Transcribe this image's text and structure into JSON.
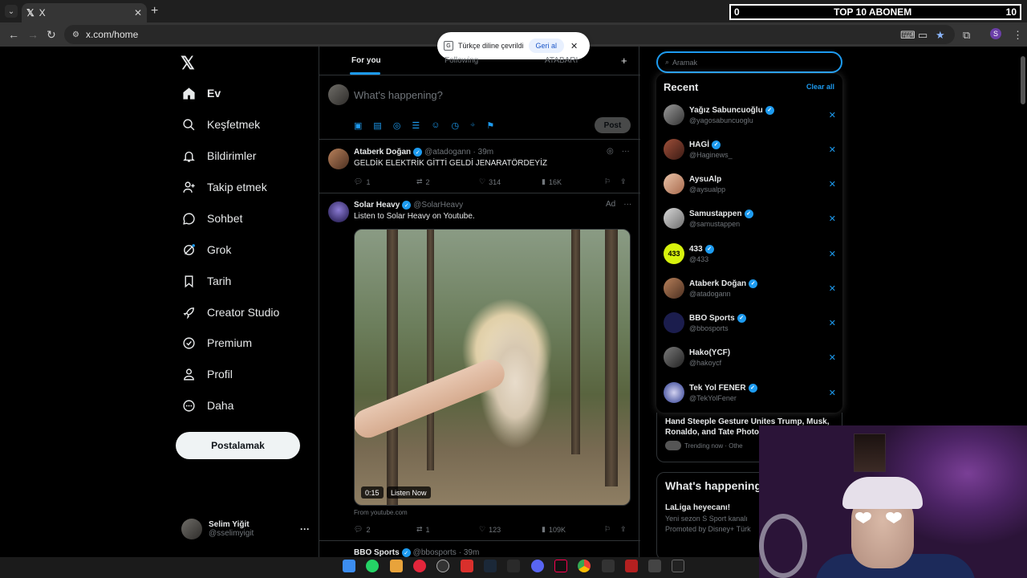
{
  "browser": {
    "tab_title": "X",
    "url": "x.com/home"
  },
  "stream_overlay": {
    "left_count": "0",
    "title": "TOP 10 ABONEM",
    "right_count": "10"
  },
  "translate_popup": {
    "text": "Türkçe diline çevrildi",
    "undo_button": "Geri al"
  },
  "sidebar": {
    "items": [
      {
        "label": "Ev",
        "icon": "home-icon"
      },
      {
        "label": "Keşfetmek",
        "icon": "search-icon"
      },
      {
        "label": "Bildirimler",
        "icon": "bell-icon"
      },
      {
        "label": "Takip etmek",
        "icon": "person-add-icon"
      },
      {
        "label": "Sohbet",
        "icon": "chat-icon"
      },
      {
        "label": "Grok",
        "icon": "grok-icon"
      },
      {
        "label": "Tarih",
        "icon": "bookmark-icon"
      },
      {
        "label": "Creator Studio",
        "icon": "rocket-icon"
      },
      {
        "label": "Premium",
        "icon": "verified-icon"
      },
      {
        "label": "Profil",
        "icon": "person-icon"
      },
      {
        "label": "Daha",
        "icon": "more-circle-icon"
      }
    ],
    "post_button": "Postalamak",
    "profile": {
      "name": "Selim Yiğit",
      "handle": "@sselimyigit"
    }
  },
  "feed": {
    "tabs": [
      "For you",
      "Following",
      "ATABARI"
    ],
    "compose_placeholder": "What's happening?",
    "compose_post_button": "Post",
    "tweets": [
      {
        "name": "Ataberk Doğan",
        "handle": "@atadogann",
        "time": "· 39m",
        "text": "GELDİK ELEKTRİK GİTTİ GELDİ JENARATÖRDEYİZ",
        "replies": "1",
        "reposts": "2",
        "likes": "314",
        "views": "16K"
      },
      {
        "name": "Solar Heavy",
        "handle": "@SolarHeavy",
        "ad_label": "Ad",
        "text": "Listen to Solar Heavy on Youtube.",
        "video_time": "0:15",
        "video_cta": "Listen Now",
        "source": "From youtube.com",
        "replies": "2",
        "reposts": "1",
        "likes": "123",
        "views": "109K"
      },
      {
        "name": "BBO Sports",
        "handle": "@bbosports",
        "time": "· 39m"
      }
    ]
  },
  "search": {
    "placeholder": "Aramak",
    "recent_title": "Recent",
    "clear_all": "Clear all",
    "recent": [
      {
        "name": "Yağız Sabuncuoğlu",
        "handle": "@yagosabuncuoglu",
        "verified": true
      },
      {
        "name": "HAGİ",
        "handle": "@Haginews_",
        "verified": true
      },
      {
        "name": "AysuAlp",
        "handle": "@aysualpp",
        "verified": false
      },
      {
        "name": "Samustappen",
        "handle": "@samustappen",
        "verified": true
      },
      {
        "name": "433",
        "handle": "@433",
        "verified": true
      },
      {
        "name": "Ataberk Doğan",
        "handle": "@atadogann",
        "verified": true
      },
      {
        "name": "BBO Sports",
        "handle": "@bbosports",
        "verified": true
      },
      {
        "name": "Hako(YCF)",
        "handle": "@hakoycf",
        "verified": false
      },
      {
        "name": "Tek Yol FENER",
        "handle": "@TekYolFener",
        "verified": true
      }
    ]
  },
  "trending": {
    "title": "Hand Steeple Gesture Unites Trump, Musk, Ronaldo, and Tate Photo",
    "meta": "Trending now · Othe"
  },
  "whats_happening": {
    "title": "What's happening",
    "item_title": "LaLiga heyecanı!",
    "item_sub": "Yeni sezon S Sport kanalı",
    "item_promo": "Promoted by Disney+ Türk"
  },
  "colors": {
    "accent": "#1d9bf0",
    "background": "#000000",
    "border": "#2f3336"
  }
}
